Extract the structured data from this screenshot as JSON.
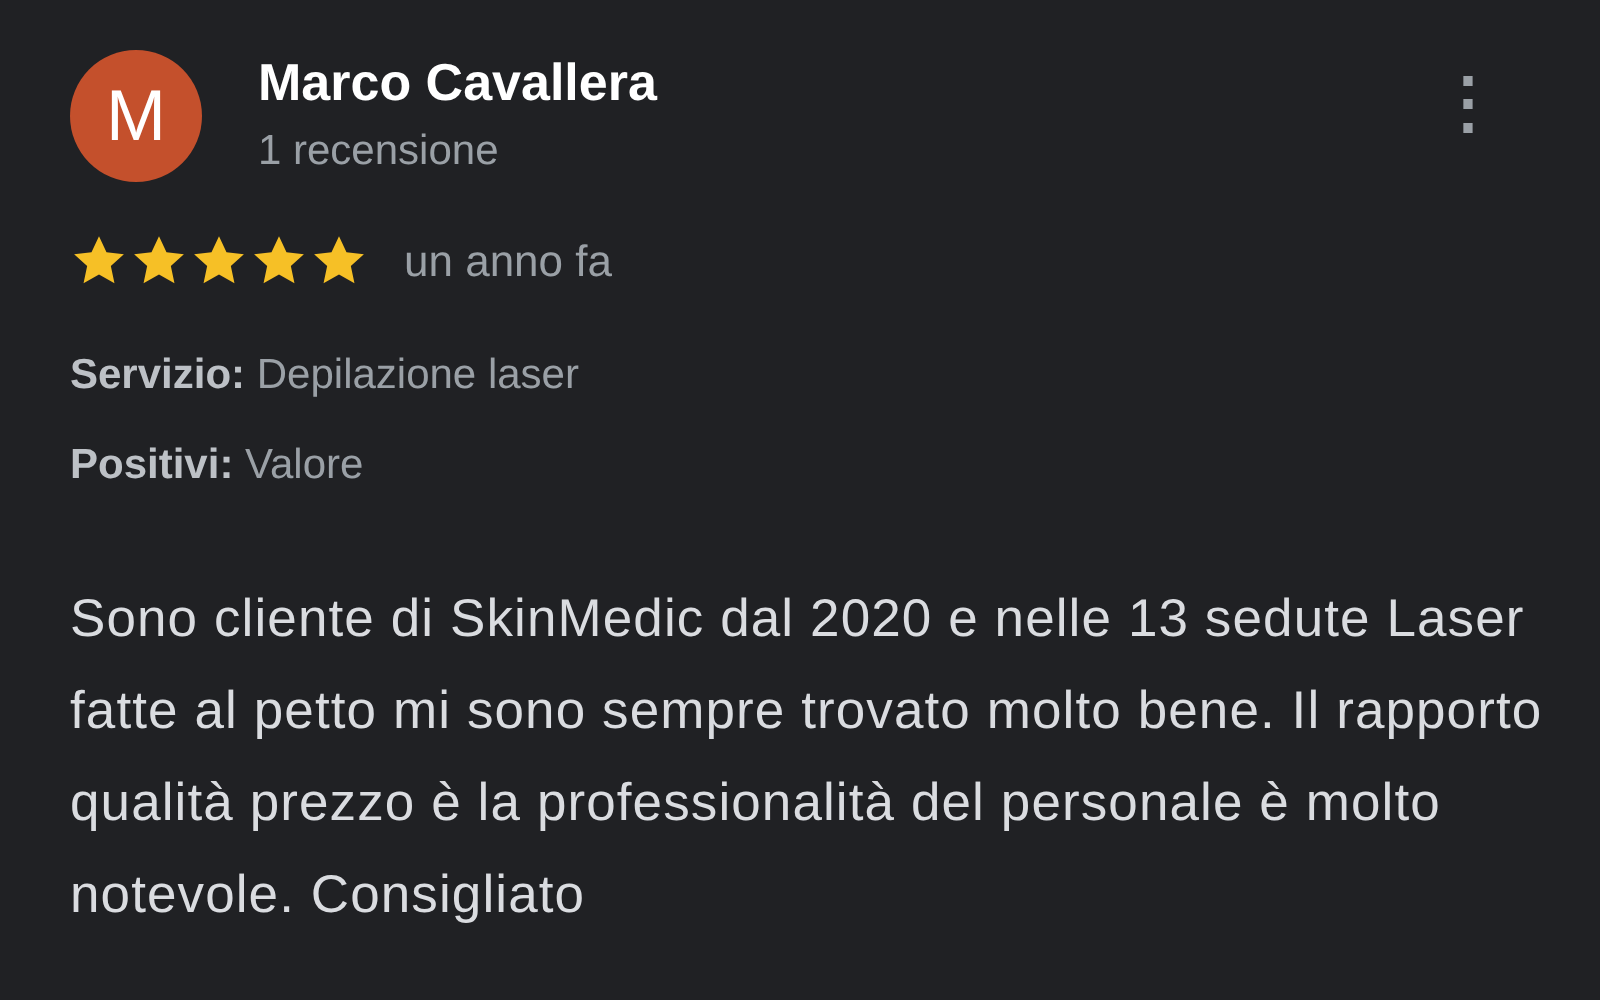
{
  "reviewer": {
    "avatar_letter": "M",
    "name": "Marco Cavallera",
    "review_count": "1 recensione",
    "menu_icon": "⋮"
  },
  "rating": {
    "stars": 5,
    "time": "un anno fa"
  },
  "details": [
    {
      "label": "Servizio:",
      "value": "Depilazione laser"
    },
    {
      "label": "Positivi:",
      "value": "Valore"
    }
  ],
  "text": "Sono cliente di SkinMedic dal 2020 e nelle 13 sedute Laser fatte al petto mi sono sempre trovato molto bene. Il rapporto qualità prezzo è la professionalità del personale è molto notevole. Consigliato"
}
